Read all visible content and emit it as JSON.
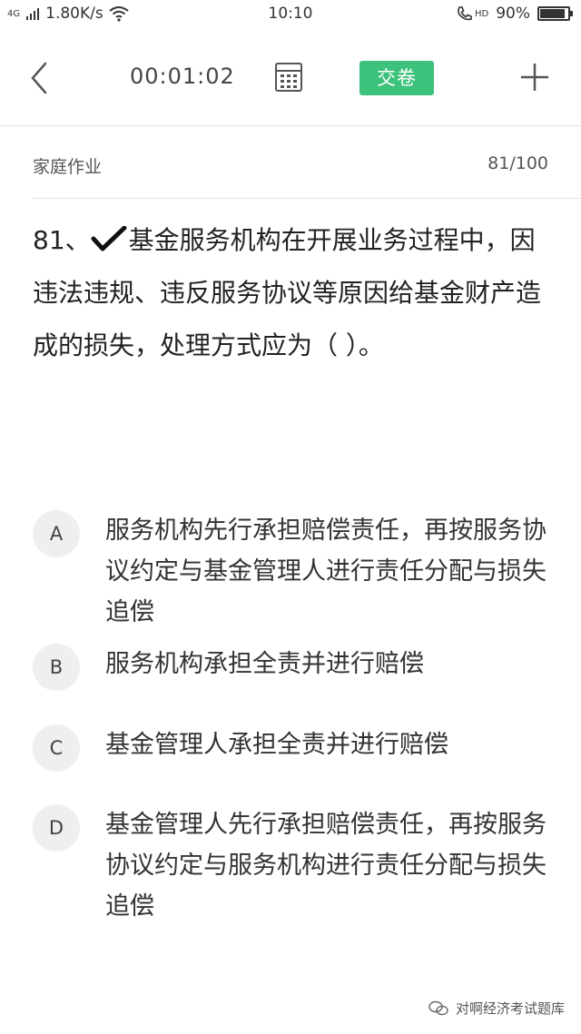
{
  "status_bar": {
    "network_speed": "1.80K/s",
    "network_type": "4G",
    "time": "10:10",
    "call_indicator": "HD",
    "battery_percent": "90%",
    "battery_level": 0.9
  },
  "toolbar": {
    "timer": "00:01:02",
    "submit_label": "交卷",
    "accent_color": "#3cc27a"
  },
  "section": {
    "title": "家庭作业",
    "progress": "81/100"
  },
  "question": {
    "number": "81、",
    "text": "基金服务机构在开展业务过程中，因违法违规、违反服务协议等原因给基金财产造成的损失，处理方式应为（ ）。"
  },
  "options": [
    {
      "letter": "A",
      "text": "服务机构先行承担赔偿责任，再按服务协议约定与基金管理人进行责任分配与损失追偿"
    },
    {
      "letter": "B",
      "text": "服务机构承担全责并进行赔偿"
    },
    {
      "letter": "C",
      "text": "基金管理人承担全责并进行赔偿"
    },
    {
      "letter": "D",
      "text": "基金管理人先行承担赔偿责任，再按服务协议约定与服务机构进行责任分配与损失追偿"
    }
  ],
  "watermark": {
    "text": "对啊经济考试题库"
  }
}
